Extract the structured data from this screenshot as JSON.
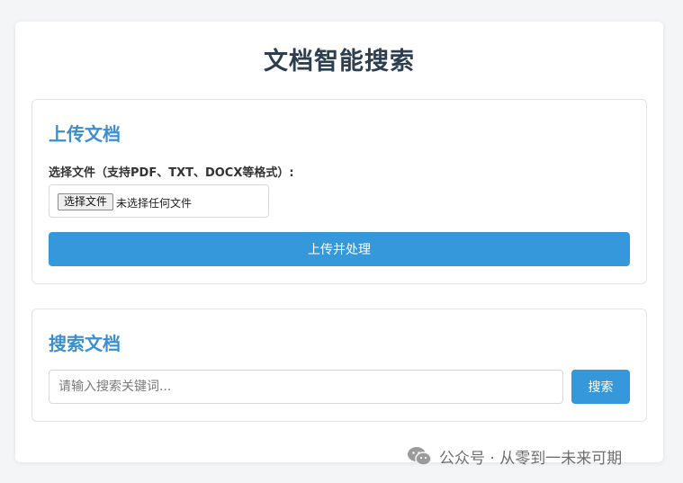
{
  "page": {
    "title": "文档智能搜索"
  },
  "upload": {
    "title": "上传文档",
    "file_label": "选择文件（支持PDF、TXT、DOCX等格式）:",
    "file_button": "选择文件",
    "file_status": "未选择任何文件",
    "submit_label": "上传并处理"
  },
  "search": {
    "title": "搜索文档",
    "placeholder": "请输入搜索关键词...",
    "button_label": "搜索"
  },
  "watermark": {
    "text": "公众号 · 从零到一未来可期",
    "icon": "wechat-icon"
  },
  "colors": {
    "accent": "#3498db",
    "section_title": "#3a8fd1",
    "page_title": "#2c3e50"
  }
}
